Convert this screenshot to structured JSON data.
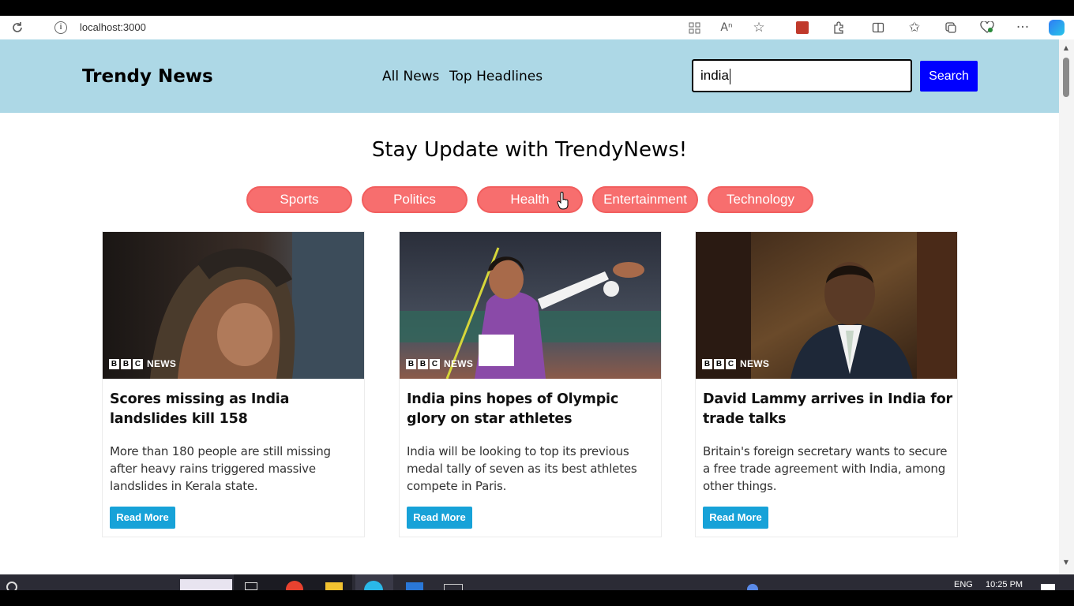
{
  "browser": {
    "url": "localhost:3000"
  },
  "navbar": {
    "brand": "Trendy News",
    "links": [
      "All News",
      "Top Headlines"
    ],
    "search_value": "india",
    "search_button": "Search"
  },
  "heading": "Stay Update with TrendyNews!",
  "categories": [
    "Sports",
    "Politics",
    "Health",
    "Entertainment",
    "Technology"
  ],
  "cards": [
    {
      "source_logo": "BBC NEWS",
      "title": "Scores missing as India landslides kill 158",
      "description": "More than 180 people are still missing after heavy rains triggered massive landslides in Kerala state.",
      "button": "Read More"
    },
    {
      "source_logo": "BBC NEWS",
      "title": "India pins hopes of Olympic glory on star athletes",
      "description": "India will be looking to top its previous medal tally of seven as its best athletes compete in Paris.",
      "button": "Read More"
    },
    {
      "source_logo": "BBC NEWS",
      "title": "David Lammy arrives in India for trade talks",
      "description": "Britain's foreign secretary wants to secure a free trade agreement with India, among other things.",
      "button": "Read More"
    }
  ],
  "taskbar": {
    "language": "ENG",
    "time": "10:25 PM"
  },
  "colors": {
    "navbar_bg": "#add8e6",
    "search_button_bg": "#0000ff",
    "pill_bg": "#f76e6e",
    "read_more_bg": "#17a2d8"
  }
}
